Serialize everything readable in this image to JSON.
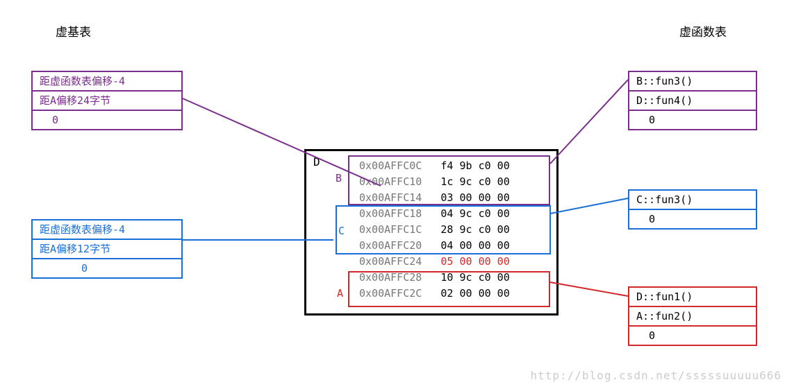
{
  "headings": {
    "left": "虚基表",
    "right": "虚函数表"
  },
  "vb_tables": {
    "purple": {
      "row1": "距虚函数表偏移-4",
      "row2": "距A偏移24字节",
      "row3": "0"
    },
    "blue": {
      "row1": "距虚函数表偏移-4",
      "row2": "距A偏移12字节",
      "row3": "0"
    }
  },
  "vf_tables": {
    "purple": {
      "r1": "B::fun3()",
      "r2": "D::fun4()",
      "r3": "0"
    },
    "blue": {
      "r1": "C::fun3()",
      "r2": "0"
    },
    "red": {
      "r1": "D::fun1()",
      "r2": "A::fun2()",
      "r3": "0"
    }
  },
  "memory": {
    "label_D": "D",
    "label_B": "B",
    "label_C": "C",
    "label_A": "A",
    "rows": [
      {
        "addr": "0x00AFFC0C",
        "bytes": "f4 9b c0 00",
        "group": "B"
      },
      {
        "addr": "0x00AFFC10",
        "bytes": "1c 9c c0 00",
        "group": "B"
      },
      {
        "addr": "0x00AFFC14",
        "bytes": "03 00 00 00",
        "group": "B"
      },
      {
        "addr": "0x00AFFC18",
        "bytes": "04 9c c0 00",
        "group": "C"
      },
      {
        "addr": "0x00AFFC1C",
        "bytes": "28 9c c0 00",
        "group": "C"
      },
      {
        "addr": "0x00AFFC20",
        "bytes": "04 00 00 00",
        "group": "C"
      },
      {
        "addr": "0x00AFFC24",
        "bytes": "05 00 00 00",
        "group": "D",
        "red": true
      },
      {
        "addr": "0x00AFFC28",
        "bytes": "10 9c c0 00",
        "group": "A"
      },
      {
        "addr": "0x00AFFC2C",
        "bytes": "02 00 00 00",
        "group": "A"
      }
    ]
  },
  "watermark": "http://blog.csdn.net/sssssuuuuu666"
}
